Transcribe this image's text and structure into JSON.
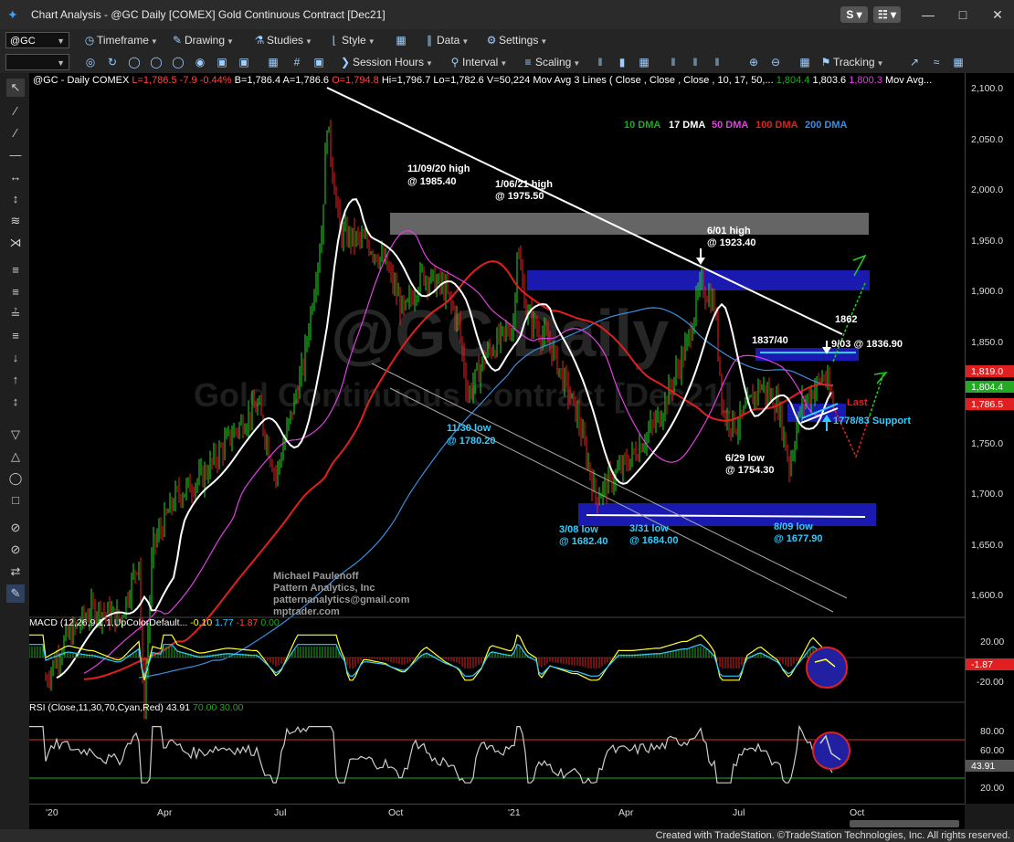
{
  "window": {
    "title": "Chart Analysis - @GC Daily [COMEX] Gold Continuous Contract [Dec21]",
    "link_s": "S",
    "link_grid": "☷",
    "minimize": "—",
    "maximize": "□",
    "close": "✕"
  },
  "toolbar1": {
    "symbol": "@GC",
    "timeframe": "Timeframe",
    "drawing": "Drawing",
    "studies": "Studies",
    "style": "Style",
    "data": "Data",
    "settings": "Settings"
  },
  "toolbar2": {
    "session_hours": "Session Hours",
    "interval": "Interval",
    "scaling": "Scaling",
    "tracking": "Tracking"
  },
  "header": {
    "symbol_info": "@GC - Daily  COMEX",
    "last": "L=1,786.5",
    "change": "-7.9",
    "change_pct": "-0.44%",
    "bid": "B=1,786.4",
    "ask": "A=1,786.6",
    "open": "O=1,794.8",
    "high": "Hi=1,796.7",
    "low": "Lo=1,782.6",
    "volume": "V=50,224",
    "study": "Mov Avg 3 Lines ( Close , Close , Close , 10, 17, 50,...",
    "ma1": "1,804.4",
    "ma2": "1,803.6",
    "ma3": "1,800.3",
    "study2": "Mov Avg..."
  },
  "watermark": {
    "line1": "@GC Daily",
    "line2": "Gold Continuous Contract [Dec21]"
  },
  "legend": [
    {
      "label": "10 DMA",
      "color": "#22aa22"
    },
    {
      "label": "17 DMA",
      "color": "#ffffff"
    },
    {
      "label": "50 DMA",
      "color": "#e040e0"
    },
    {
      "label": "100 DMA",
      "color": "#e02020"
    },
    {
      "label": "200 DMA",
      "color": "#3a8fe0"
    }
  ],
  "annotations": {
    "a1": "11/09/20 high",
    "a1b": "@ 1985.40",
    "a2": "1/06/21 high",
    "a2b": "@ 1975.50",
    "a3": "6/01 high",
    "a3b": "@ 1923.40",
    "a4": "11/30 low",
    "a4b": "@ 1780.20",
    "a5": "3/08 low",
    "a5b": "@ 1682.40",
    "a6": "3/31 low",
    "a6b": "@ 1684.00",
    "a7": "6/29 low",
    "a7b": "@ 1754.30",
    "a8": "8/09 low",
    "a8b": "@ 1677.90",
    "a9": "1837/40",
    "a10": "1862",
    "a11": "9/03 @ 1836.90",
    "a12": "Last",
    "a13": "1778/83 Support"
  },
  "credits": {
    "name": "Michael Paulenoff",
    "company": "Pattern Analytics, Inc",
    "email": "patternanalytics@gmail.com",
    "site": "mptrader.com"
  },
  "price_axis": {
    "ticks": [
      "2,100.0",
      "2,050.0",
      "2,000.0",
      "1,950.0",
      "1,900.0",
      "1,850.0",
      "1,800.0",
      "1,750.0",
      "1,700.0",
      "1,650.0",
      "1,600.0"
    ],
    "tags": [
      {
        "value": "1,819.0",
        "color": "#e02020"
      },
      {
        "value": "1,804.4",
        "color": "#22aa22"
      },
      {
        "value": "1,786.5",
        "color": "#e02020"
      }
    ]
  },
  "macd": {
    "label": "MACD (12,26,9,1,1,UpColorDefault...",
    "v1": "-0.10",
    "v2": "1.77",
    "v3": "-1.87",
    "v4": "0.00",
    "ticks": [
      "20.00",
      "-20.00"
    ],
    "tag": "-1.87"
  },
  "rsi": {
    "label": "RSI (Close,11,30,70,Cyan,Red)",
    "v1": "43.91",
    "v2": "70.00",
    "v3": "30.00",
    "ticks": [
      "80.00",
      "60.00",
      "20.00"
    ],
    "tag": "43.91"
  },
  "date_axis": [
    "'20",
    "Apr",
    "Jul",
    "Oct",
    "'21",
    "Apr",
    "Jul",
    "Oct"
  ],
  "footer": "Created with TradeStation. ©TradeStation Technologies, Inc. All rights reserved."
}
